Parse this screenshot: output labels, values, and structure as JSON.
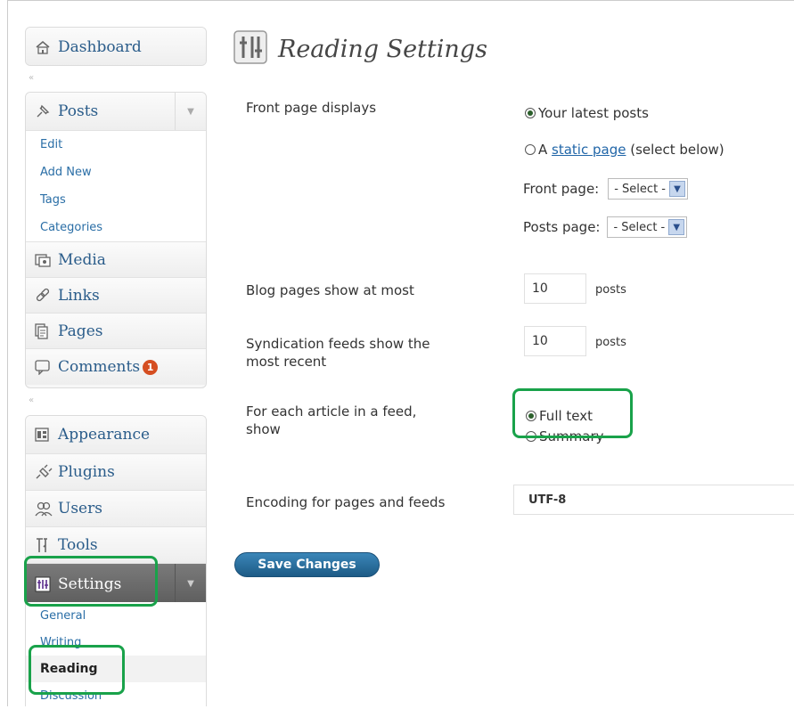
{
  "sidebar": {
    "dashboard": "Dashboard",
    "posts": {
      "label": "Posts",
      "sub": [
        "Edit",
        "Add New",
        "Tags",
        "Categories"
      ]
    },
    "media": "Media",
    "links": "Links",
    "pages": "Pages",
    "comments": {
      "label": "Comments",
      "badge": "1"
    },
    "appearance": "Appearance",
    "plugins": "Plugins",
    "users": "Users",
    "tools": "Tools",
    "settings": {
      "label": "Settings",
      "sub": [
        "General",
        "Writing",
        "Reading",
        "Discussion"
      ]
    },
    "separator_icon": "«",
    "toggle_icon": "▼"
  },
  "main": {
    "title": "Reading Settings",
    "front_page": {
      "label": "Front page displays",
      "option_latest": "Your latest posts",
      "option_static_prefix": "A ",
      "option_static_link": "static page",
      "option_static_suffix": " (select below)",
      "front_page_label": "Front page:",
      "posts_page_label": "Posts page:",
      "select_value": "- Select -"
    },
    "blog_pages": {
      "label": "Blog pages show at most",
      "value": "10",
      "unit": "posts"
    },
    "syndication": {
      "label_line1": "Syndication feeds show the",
      "label_line2": "most recent",
      "value": "10",
      "unit": "posts"
    },
    "article_feed": {
      "label_line1": "For each article in a feed,",
      "label_line2": "show",
      "option_full": "Full text",
      "option_summary": "Summary"
    },
    "encoding": {
      "label": "Encoding for pages and feeds",
      "value": "UTF-8"
    },
    "save_label": "Save Changes"
  },
  "colors": {
    "highlight": "#19a24a",
    "link": "#2166a8",
    "badge": "#d54e21",
    "button": "#21638f"
  }
}
